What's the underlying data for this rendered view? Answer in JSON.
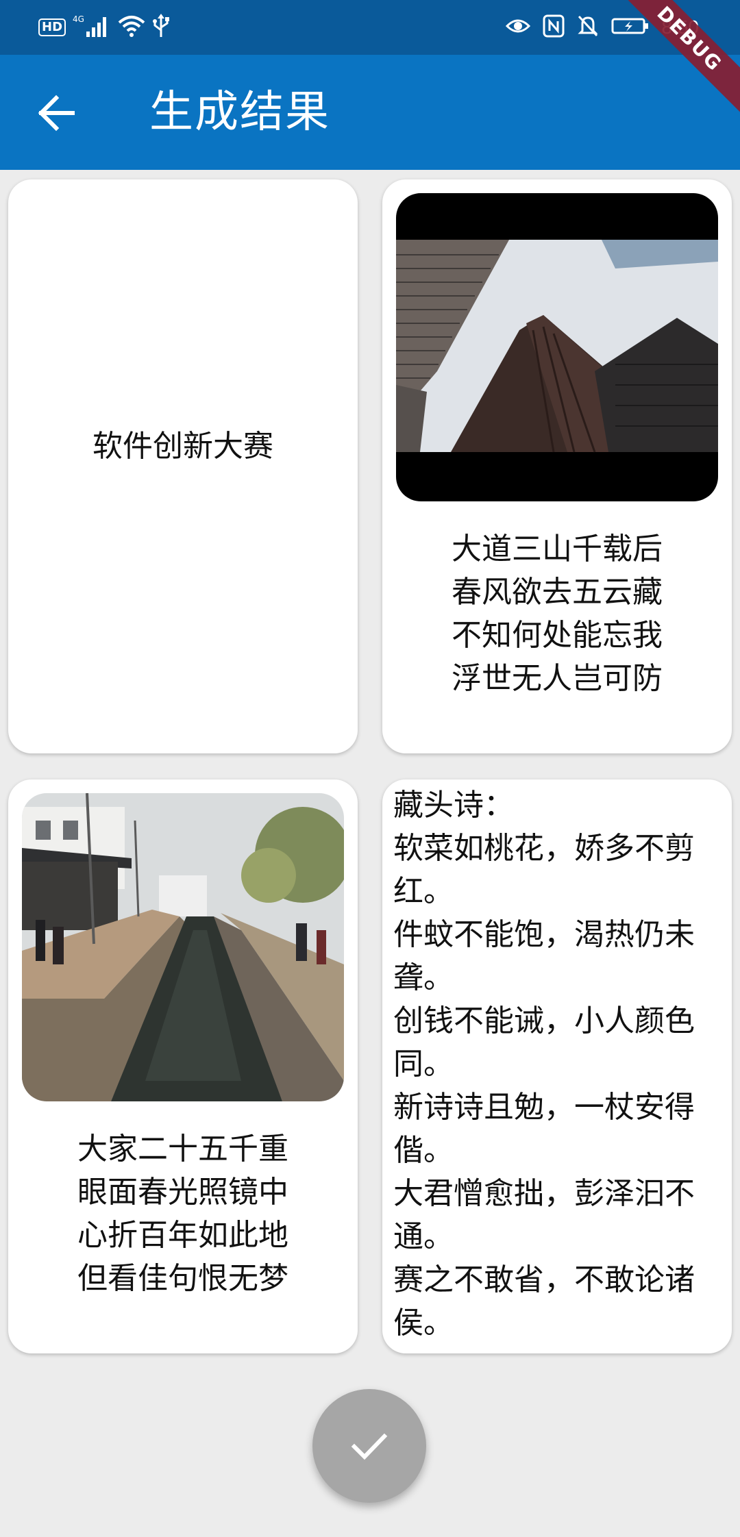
{
  "status_bar": {
    "hd_label": "HD",
    "network_label": "4G",
    "time": "8:50",
    "icons": [
      "signal-icon",
      "wifi-icon",
      "usb-icon",
      "eye-icon",
      "nfc-icon",
      "mute-icon",
      "battery-icon"
    ]
  },
  "debug_banner": "DEBUG",
  "app_bar": {
    "title": "生成结果",
    "back_icon": "arrow-left-icon",
    "background": "#0a74c2"
  },
  "cards": {
    "card1": {
      "text": "软件创新大赛"
    },
    "card2": {
      "image_icon": "skyscrapers-photo",
      "poem": [
        "大道三山千载后",
        "春风欲去五云藏",
        "不知何处能忘我",
        "浮世无人岂可防"
      ]
    },
    "card3": {
      "image_icon": "canal-photo",
      "poem": [
        "大家二十五千重",
        "眼面春光照镜中",
        "心折百年如此地",
        "但看佳句恨无梦"
      ]
    },
    "card4": {
      "heading": "藏头诗：",
      "lines": [
        "软菜如桃花，娇多不剪红。",
        "件蚊不能饱，渴热仍未聋。",
        "创钱不能诫，小人颜色同。",
        "新诗诗且勉，一杖安得偕。",
        "大君憎愈拙，彭泽汩不通。",
        "赛之不敢省，不敢论诸侯。"
      ]
    }
  },
  "fab": {
    "icon": "check-icon",
    "color": "#a6a6a6"
  }
}
